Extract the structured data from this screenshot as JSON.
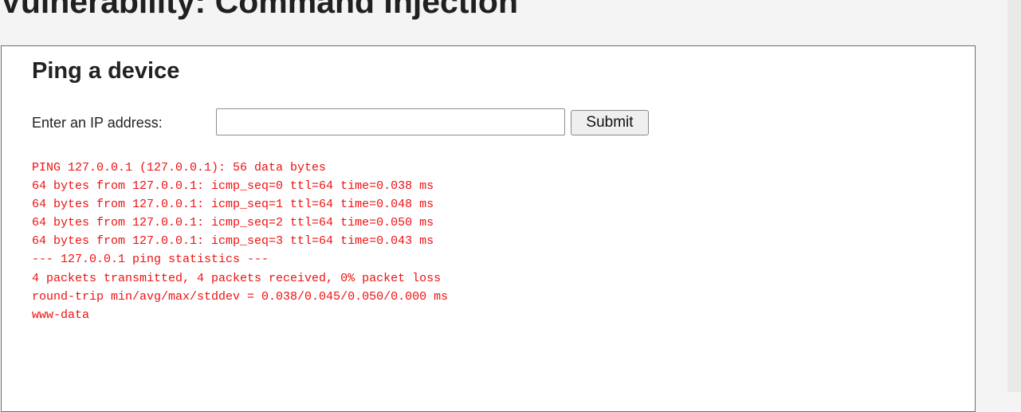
{
  "page": {
    "heading": "Vulnerability: Command Injection"
  },
  "box": {
    "title": "Ping a device",
    "ip_label": "Enter an IP address:",
    "ip_value": "",
    "ip_placeholder": "",
    "submit_label": "Submit"
  },
  "output": {
    "lines": [
      "PING 127.0.0.1 (127.0.0.1): 56 data bytes",
      "64 bytes from 127.0.0.1: icmp_seq=0 ttl=64 time=0.038 ms",
      "64 bytes from 127.0.0.1: icmp_seq=1 ttl=64 time=0.048 ms",
      "64 bytes from 127.0.0.1: icmp_seq=2 ttl=64 time=0.050 ms",
      "64 bytes from 127.0.0.1: icmp_seq=3 ttl=64 time=0.043 ms",
      "--- 127.0.0.1 ping statistics ---",
      "4 packets transmitted, 4 packets received, 0% packet loss",
      "round-trip min/avg/max/stddev = 0.038/0.045/0.050/0.000 ms",
      "www-data"
    ],
    "color": "#ee1111"
  },
  "colors": {
    "page_background": "#f4f4f4",
    "box_background": "#ffffff",
    "box_border": "#6e6e6e"
  }
}
